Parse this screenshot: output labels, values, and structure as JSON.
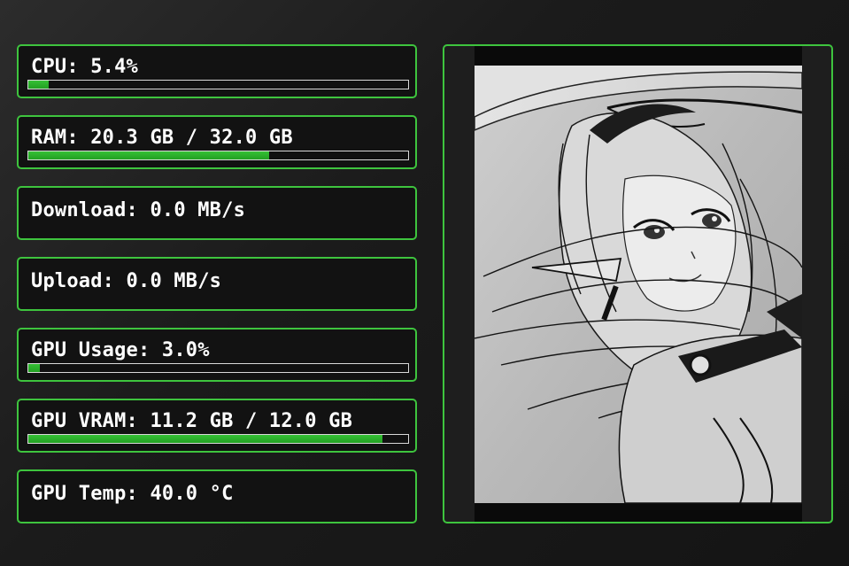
{
  "stats": {
    "cpu": {
      "label": "CPU: 5.4%",
      "value_percent": 5.4
    },
    "ram": {
      "label": "RAM: 20.3 GB / 32.0 GB",
      "value_percent": 63.4
    },
    "download": {
      "label": "Download: 0.0 MB/s"
    },
    "upload": {
      "label": "Upload: 0.0 MB/s"
    },
    "gpu_usage": {
      "label": "GPU Usage: 3.0%",
      "value_percent": 3.0
    },
    "gpu_vram": {
      "label": "GPU VRAM: 11.2 GB / 12.0 GB",
      "value_percent": 93.3
    },
    "gpu_temp": {
      "label": "GPU Temp: 40.0 °C"
    }
  },
  "colors": {
    "accent": "#3ec43e",
    "card_background": "#121212",
    "bar_fill": "#2bb02b"
  },
  "image": {
    "icon": "manga-illustration"
  }
}
